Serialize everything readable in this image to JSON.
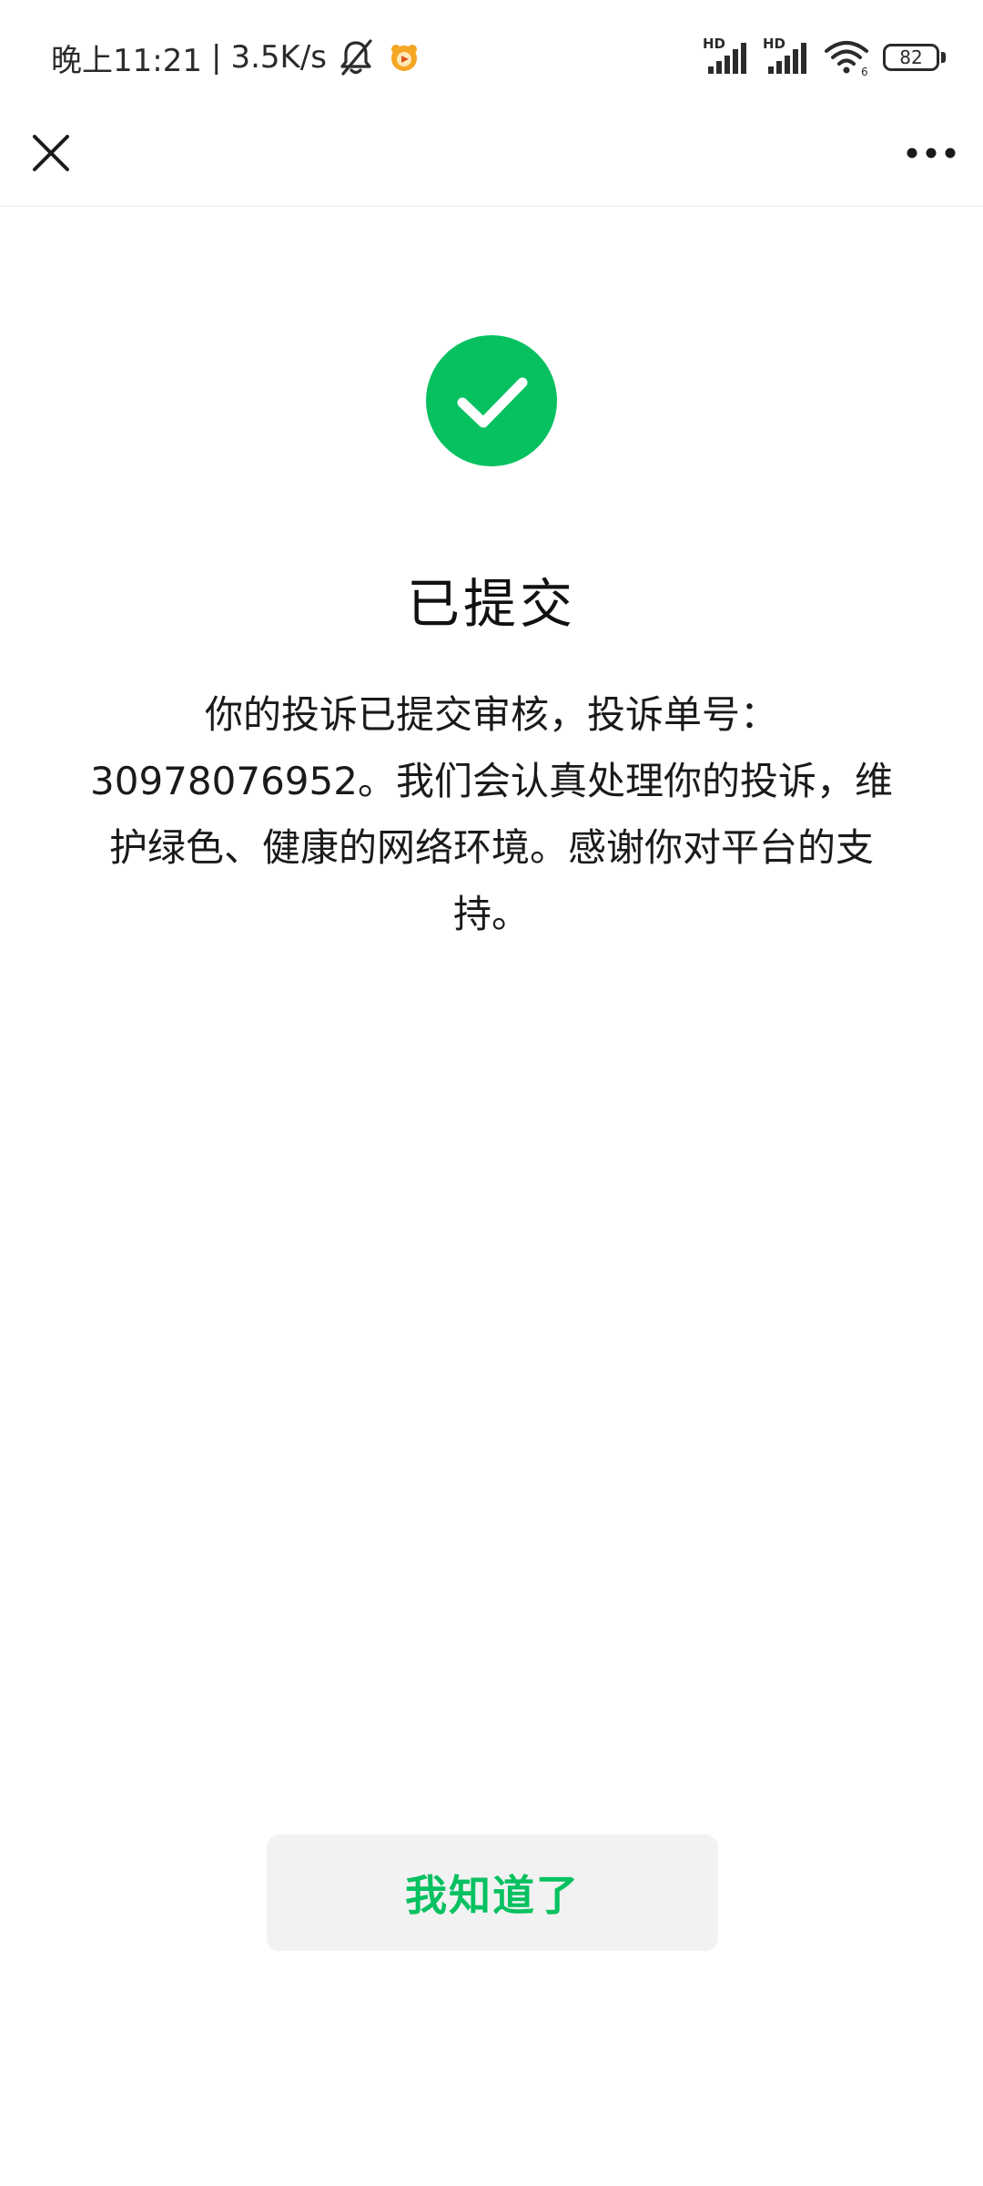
{
  "status_bar": {
    "time": "晚上11:21",
    "separator": "|",
    "net_speed": "3.5K/s",
    "signal_1_label": "HD",
    "signal_2_label": "HD",
    "battery_level": "82",
    "icons": [
      "bell-muted-icon",
      "app-notification-icon",
      "signal-icon",
      "signal-icon",
      "wifi-icon",
      "battery-icon"
    ]
  },
  "nav": {
    "close_icon": "close-icon",
    "more_icon": "more-icon"
  },
  "result": {
    "icon": "checkmark-circle-icon",
    "accent_color": "#07c160",
    "title": "已提交",
    "message": "你的投诉已提交审核，投诉单号：30978076952。我们会认真处理你的投诉，维护绿色、健康的网络环境。感谢你对平台的支持。"
  },
  "actions": {
    "ack_label": "我知道了"
  }
}
